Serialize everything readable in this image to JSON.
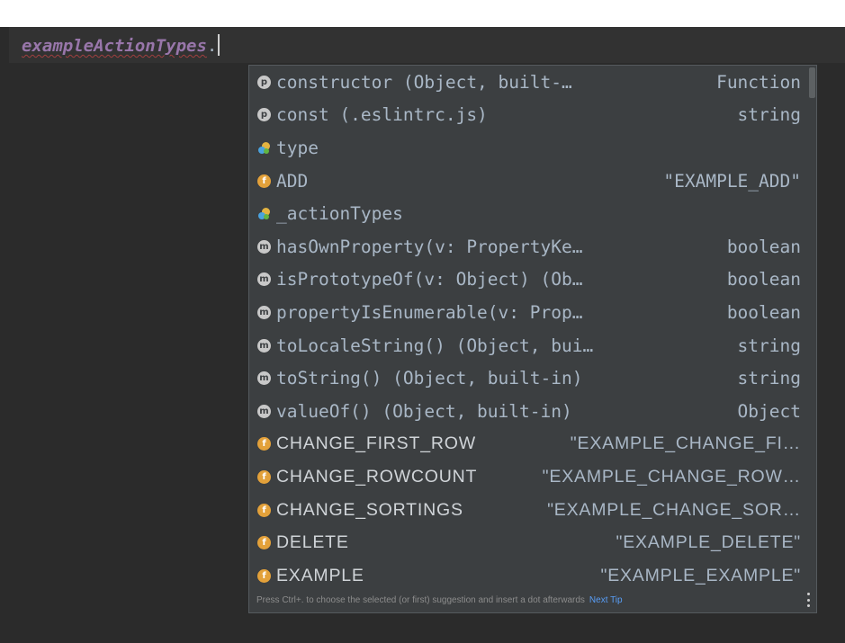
{
  "editor": {
    "identifier": "exampleActionTypes",
    "typed": "."
  },
  "completion": {
    "items": [
      {
        "icon": "property-icon",
        "badge": "p",
        "kind": "property",
        "name": "constructor (Object, built-…",
        "type": "Function",
        "style": "mono"
      },
      {
        "icon": "property-icon",
        "badge": "p",
        "kind": "property",
        "name": "const (.eslintrc.js)",
        "type": "string",
        "style": "mono"
      },
      {
        "icon": "variable-icon",
        "badge": "",
        "kind": "variable",
        "name": "type",
        "type": "",
        "style": "mono"
      },
      {
        "icon": "field-icon",
        "badge": "f",
        "kind": "field",
        "name": "ADD",
        "type": "\"EXAMPLE_ADD\"",
        "style": "mono-static"
      },
      {
        "icon": "variable-icon",
        "badge": "",
        "kind": "variable",
        "name": "_actionTypes",
        "type": "",
        "style": "mono"
      },
      {
        "icon": "method-icon",
        "badge": "m",
        "kind": "method",
        "name": "hasOwnProperty(v: PropertyKe…",
        "type": "boolean",
        "style": "mono"
      },
      {
        "icon": "method-icon",
        "badge": "m",
        "kind": "method",
        "name": "isPrototypeOf(v: Object) (Ob…",
        "type": "boolean",
        "style": "mono"
      },
      {
        "icon": "method-icon",
        "badge": "m",
        "kind": "method",
        "name": "propertyIsEnumerable(v: Prop…",
        "type": "boolean",
        "style": "mono"
      },
      {
        "icon": "method-icon",
        "badge": "m",
        "kind": "method",
        "name": "toLocaleString() (Object, bui…",
        "type": "string",
        "style": "mono"
      },
      {
        "icon": "method-icon",
        "badge": "m",
        "kind": "method",
        "name": "toString() (Object, built-in)",
        "type": "string",
        "style": "mono"
      },
      {
        "icon": "method-icon",
        "badge": "m",
        "kind": "method",
        "name": "valueOf() (Object, built-in)",
        "type": "Object",
        "style": "mono"
      },
      {
        "icon": "field-icon",
        "badge": "f",
        "kind": "field",
        "name": "CHANGE_FIRST_ROW",
        "type": "\"EXAMPLE_CHANGE_FI…",
        "style": "static"
      },
      {
        "icon": "field-icon",
        "badge": "f",
        "kind": "field",
        "name": "CHANGE_ROWCOUNT",
        "type": "\"EXAMPLE_CHANGE_ROW…",
        "style": "static"
      },
      {
        "icon": "field-icon",
        "badge": "f",
        "kind": "field",
        "name": "CHANGE_SORTINGS",
        "type": "\"EXAMPLE_CHANGE_SOR…",
        "style": "static"
      },
      {
        "icon": "field-icon",
        "badge": "f",
        "kind": "field",
        "name": "DELETE",
        "type": "\"EXAMPLE_DELETE\"",
        "style": "static"
      },
      {
        "icon": "field-icon",
        "badge": "f",
        "kind": "field",
        "name": "EXAMPLE",
        "type": "\"EXAMPLE_EXAMPLE\"",
        "style": "static"
      }
    ],
    "footer": {
      "hint": "Press Ctrl+. to choose the selected (or first) suggestion and insert a dot afterwards",
      "link": "Next Tip"
    }
  },
  "colors": {
    "background": "#2b2b2b",
    "popup": "#3c3f41",
    "identifier": "#9876aa",
    "text": "#a9b7c6",
    "field_badge": "#e3a13a",
    "link": "#589df6"
  }
}
